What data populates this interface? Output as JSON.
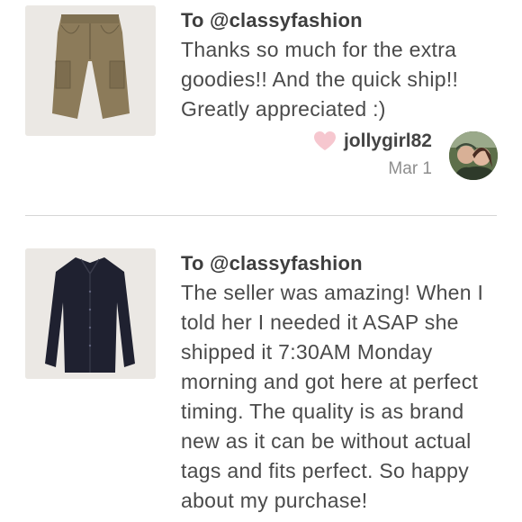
{
  "reviews": [
    {
      "to": "To @classyfashion",
      "message": "Thanks so much for the extra goodies!! And the quick ship!! Greatly appreciated :)",
      "username": "jollygirl82",
      "date": "Mar 1",
      "product_image": "khaki-cargo-shorts",
      "heart_color": "#f6c7cf"
    },
    {
      "to": "To @classyfashion",
      "message": "The seller was amazing! When I told her I needed it ASAP she shipped it 7:30AM Monday morning and got here at perfect timing. The quality is as brand new as it can be without actual tags and fits perfect. So happy about my purchase!",
      "product_image": "black-button-down-shirt"
    }
  ]
}
